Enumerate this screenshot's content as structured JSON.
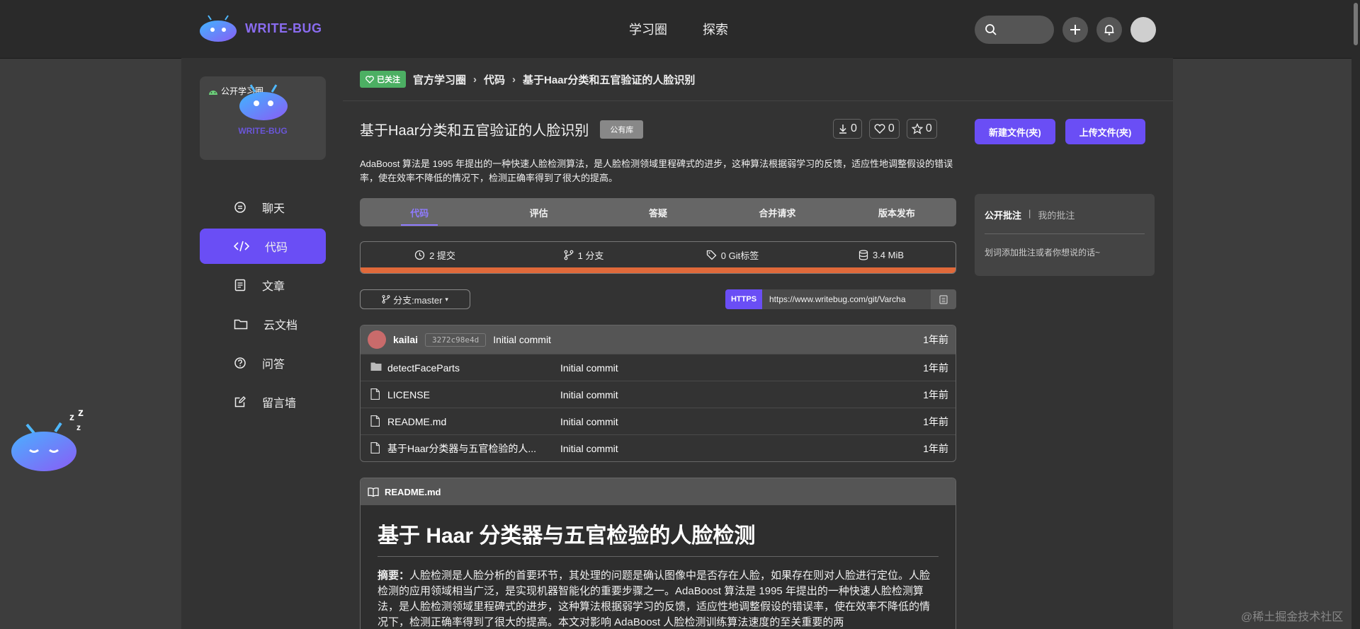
{
  "brand": {
    "name": "WRITE-BUG",
    "color": "#8a6cf0"
  },
  "nav": {
    "items": [
      "学习圈",
      "探索"
    ]
  },
  "left": {
    "group_tag": "公开学习圈",
    "group_name": "WRITE-BUG",
    "menu": [
      {
        "label": "聊天",
        "icon": "chat-icon"
      },
      {
        "label": "代码",
        "icon": "code-icon"
      },
      {
        "label": "文章",
        "icon": "article-icon"
      },
      {
        "label": "云文档",
        "icon": "folder-icon"
      },
      {
        "label": "问答",
        "icon": "question-icon"
      },
      {
        "label": "留言墙",
        "icon": "edit-icon"
      }
    ],
    "active_index": 1
  },
  "breadcrumb": {
    "follow_label": "已关注",
    "items": [
      "官方学习圈",
      "代码",
      "基于Haar分类和五官验证的人脸识别"
    ]
  },
  "repo": {
    "title": "基于Haar分类和五官验证的人脸识别",
    "visibility": "公有库",
    "downloads": "0",
    "likes": "0",
    "stars": "0",
    "description": "AdaBoost 算法是 1995 年提出的一种快速人脸检测算法，是人脸检测领域里程碑式的进步，这种算法根据弱学习的反馈，适应性地调整假设的错误率，使在效率不降低的情况下，检测正确率得到了很大的提高。"
  },
  "tabs": [
    "代码",
    "评估",
    "答疑",
    "合并请求",
    "版本发布"
  ],
  "summary": {
    "commits": "2 提交",
    "branches": "1 分支",
    "tags": "0 Git标签",
    "size": "3.4 MiB",
    "language_color": "#e0693a"
  },
  "branch": {
    "label": "分支:master"
  },
  "clone": {
    "protocol": "HTTPS",
    "url": "https://www.writebug.com/git/Varcha"
  },
  "last_commit": {
    "user": "kailai",
    "hash": "3272c98e4d",
    "message": "Initial commit",
    "time": "1年前"
  },
  "files": [
    {
      "name": "detectFaceParts",
      "type": "folder",
      "message": "Initial commit",
      "time": "1年前"
    },
    {
      "name": "LICENSE",
      "type": "file",
      "message": "Initial commit",
      "time": "1年前"
    },
    {
      "name": "README.md",
      "type": "file",
      "message": "Initial commit",
      "time": "1年前"
    },
    {
      "name": "基于Haar分类器与五官检验的人...",
      "type": "file",
      "message": "Initial commit",
      "time": "1年前"
    }
  ],
  "readme": {
    "filename": "README.md",
    "heading": "基于 Haar 分类器与五官检验的人脸检测",
    "abstract_label": "摘要：",
    "abstract_text": "人脸检测是人脸分析的首要环节，其处理的问题是确认图像中是否存在人脸，如果存在则对人脸进行定位。人脸检测的应用领域相当广泛，是实现机器智能化的重要步骤之一。AdaBoost 算法是 1995 年提出的一种快速人脸检测算法，是人脸检测领域里程碑式的进步，这种算法根据弱学习的反馈，适应性地调整假设的错误率，使在效率不降低的情况下，检测正确率得到了很大的提高。本文对影响 AdaBoost 人脸检测训练算法速度的至关重要的两"
  },
  "actions": {
    "new_file": "新建文件(夹)",
    "upload_file": "上传文件(夹)"
  },
  "annotations": {
    "public_tab": "公开批注",
    "separator": "|",
    "mine_tab": "我的批注",
    "hint": "划词添加批注或者你想说的话~"
  },
  "watermark": "@稀土掘金技术社区",
  "colors": {
    "accent": "#6a4ef5",
    "follow": "#4caf63"
  }
}
